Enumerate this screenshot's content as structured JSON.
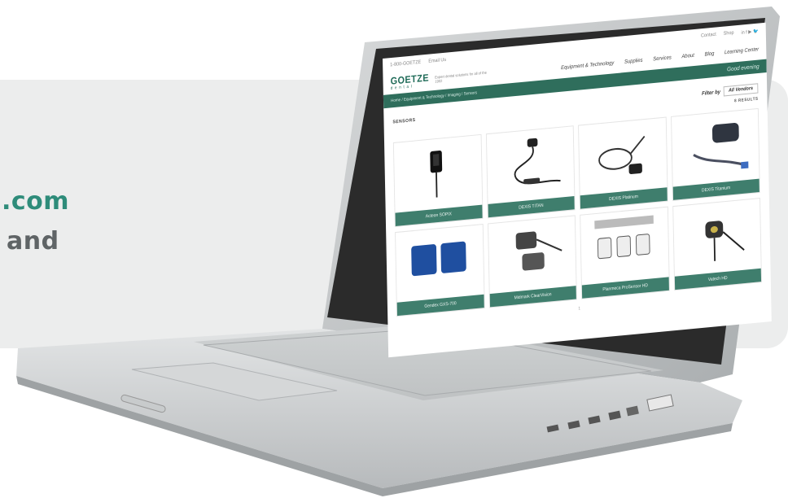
{
  "promo": {
    "line1": ".com",
    "line2": "and"
  },
  "site": {
    "topbar": {
      "phone": "1-800-GOETZE",
      "email": "Email Us",
      "contact": "Contact",
      "shop": "Shop",
      "social": "in  f  ▶  🐦"
    },
    "logo_main": "GOETZE",
    "logo_sub": "dental",
    "tagline": "Expert dental solutions for all of the 1902",
    "nav": [
      "Equipment & Technology",
      "Supplies",
      "Services",
      "About",
      "Blog",
      "Learning Center"
    ],
    "breadcrumb": "Home / Equipment & Technology / Imaging / Sensors",
    "greeting": "Good evening",
    "section_title": "SENSORS",
    "filter_label": "Filter by",
    "filter_value": "All Vendors",
    "results": "8 RESULTS",
    "products": [
      {
        "label": "Acteon SOPIX"
      },
      {
        "label": "DEXIS TITAN"
      },
      {
        "label": "DEXIS Platinum"
      },
      {
        "label": "DEXIS Titanium"
      },
      {
        "label": "Gendex GXS-700"
      },
      {
        "label": "Midmark ClearVision"
      },
      {
        "label": "Planmeca ProSensor HD"
      },
      {
        "label": "Vatech HD"
      }
    ],
    "pager": "1"
  },
  "colors": {
    "accent": "#2e8c7a",
    "brand_green": "#2f6e5c",
    "card_label": "#3f7e6d"
  }
}
